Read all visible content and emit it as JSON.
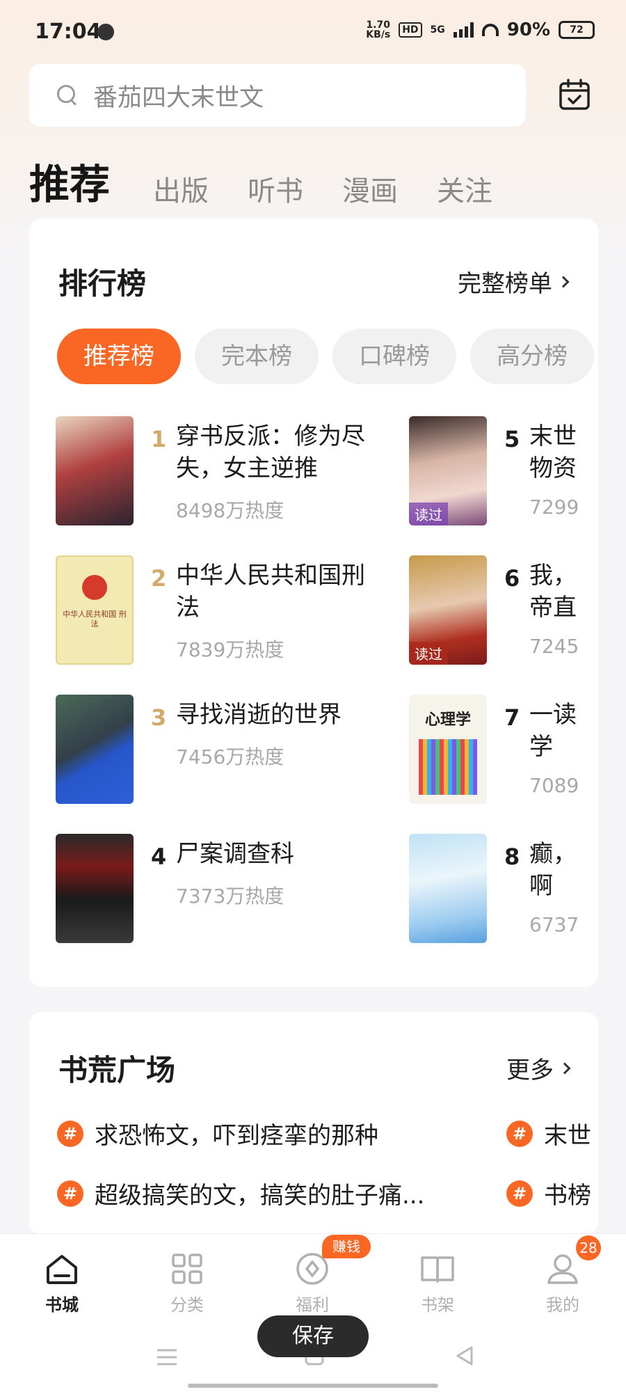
{
  "status_bar": {
    "time": "17:04",
    "speed_value": "1.70",
    "speed_unit": "KB/s",
    "hd_label": "HD",
    "network_label": "5G",
    "battery_percent": "90%",
    "battery_level": "72"
  },
  "search": {
    "placeholder": "番茄四大末世文"
  },
  "tabs": [
    {
      "label": "推荐",
      "active": true
    },
    {
      "label": "出版"
    },
    {
      "label": "听书"
    },
    {
      "label": "漫画"
    },
    {
      "label": "关注"
    }
  ],
  "ranking": {
    "title": "排行榜",
    "more_label": "完整榜单",
    "chips": [
      "推荐榜",
      "完本榜",
      "口碑榜",
      "高分榜"
    ],
    "books": [
      {
        "rank": "1",
        "title": "穿书反派：修为尽失，女主逆推",
        "heat": "8498万热度"
      },
      {
        "rank": "2",
        "title": "中华人民共和国刑法",
        "heat": "7839万热度",
        "cover_text": "中华人民共和国 刑 法"
      },
      {
        "rank": "3",
        "title": "寻找消逝的世界",
        "heat": "7456万热度"
      },
      {
        "rank": "4",
        "title": "尸案调查科",
        "heat": "7373万热度"
      },
      {
        "rank": "5",
        "title": "末世物资",
        "heat": "7299",
        "badge": "读过"
      },
      {
        "rank": "6",
        "title": "我，帝直",
        "heat": "7245",
        "badge": "读过"
      },
      {
        "rank": "7",
        "title": "一读学",
        "heat": "7089",
        "cover_text": "心理学"
      },
      {
        "rank": "8",
        "title": "癫，啊",
        "heat": "6737"
      }
    ]
  },
  "shortage": {
    "title": "书荒广场",
    "more_label": "更多",
    "topics": [
      "求恐怖文，吓到痉挛的那种",
      "超级搞笑的文，搞笑的肚子痛...",
      "末世",
      "书榜"
    ]
  },
  "bottom_nav": {
    "items": [
      {
        "label": "书城",
        "icon": "home-icon",
        "active": true
      },
      {
        "label": "分类",
        "icon": "grid-icon"
      },
      {
        "label": "福利",
        "icon": "coin-icon"
      },
      {
        "label": "书架",
        "icon": "book-icon"
      },
      {
        "label": "我的",
        "icon": "user-icon"
      }
    ],
    "earn_badge": "赚钱",
    "profile_count": "28"
  },
  "save_label": "保存",
  "colors": {
    "accent": "#fa6725",
    "rank_gold": "#d3aa6b"
  }
}
